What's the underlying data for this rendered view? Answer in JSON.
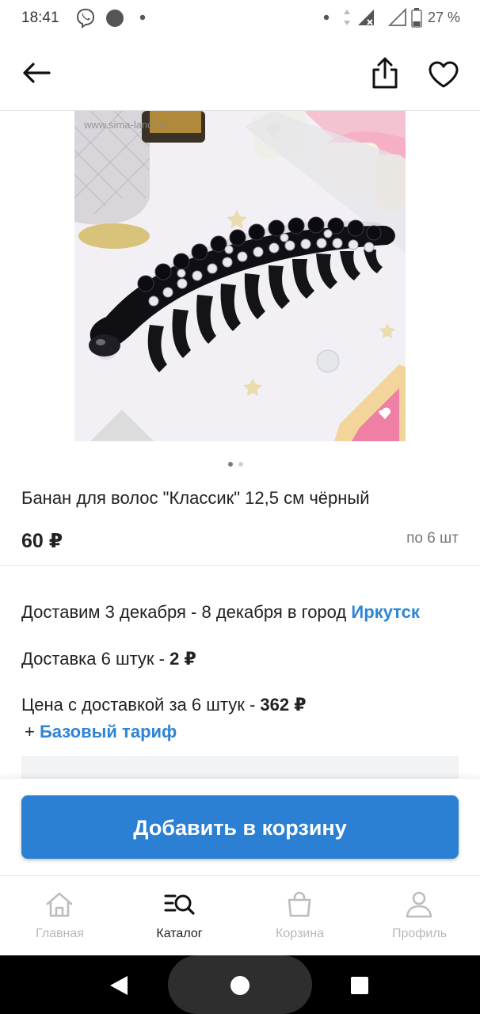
{
  "status_bar": {
    "time": "18:41",
    "battery": "27 %"
  },
  "product": {
    "watermark": "www.sima-land.ru",
    "title": "Банан для волос \"Классик\" 12,5 см чёрный",
    "price": "60 ₽",
    "per_pack": "по 6 шт"
  },
  "delivery": {
    "date_text": "Доставим 3 декабря - 8 декабря в город",
    "city": "Иркутск",
    "cost_label": "Доставка 6 штук  - ",
    "cost_value": "2 ₽",
    "total_label": "Цена с доставкой за 6 штук - ",
    "total_value": "362 ₽",
    "tariff_plus": "+ ",
    "tariff": "Базовый тариф"
  },
  "actions": {
    "add_to_cart": "Добавить в корзину"
  },
  "tabs": [
    {
      "label": "Главная",
      "icon": "home-icon"
    },
    {
      "label": "Каталог",
      "icon": "catalog-search-icon"
    },
    {
      "label": "Корзина",
      "icon": "bag-icon"
    },
    {
      "label": "Профиль",
      "icon": "profile-icon"
    }
  ],
  "carousel": {
    "pages": 2,
    "active": 1
  },
  "colors": {
    "accent": "#2b80d4",
    "link": "#2d85d6",
    "inactive_tab": "#b8b8b8"
  }
}
